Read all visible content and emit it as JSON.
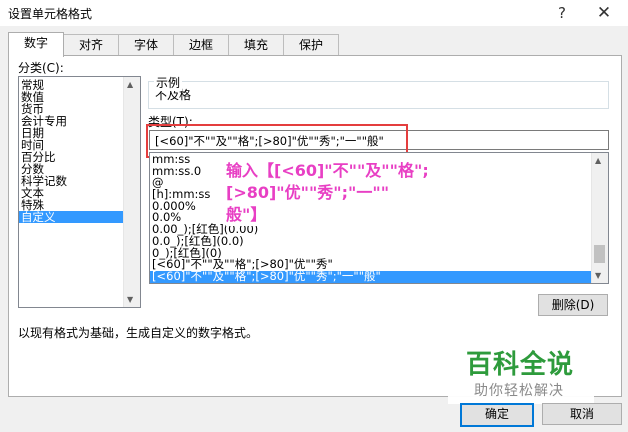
{
  "window": {
    "title": "设置单元格格式",
    "help_glyph": "?",
    "close_glyph": "✕"
  },
  "tabs": [
    "数字",
    "对齐",
    "字体",
    "边框",
    "填充",
    "保护"
  ],
  "category": {
    "label": "分类(C):",
    "items": [
      "常规",
      "数值",
      "货币",
      "会计专用",
      "日期",
      "时间",
      "百分比",
      "分数",
      "科学记数",
      "文本",
      "特殊",
      "自定义"
    ],
    "selected": "自定义"
  },
  "sample": {
    "label": "示例",
    "value": "不及格"
  },
  "type": {
    "label": "类型(T):",
    "value": "[<60]\"不\"\"及\"\"格\";[>80]\"优\"\"秀\";\"一\"\"般\"",
    "list": [
      "mm:ss",
      "mm:ss.0",
      "@",
      "[h]:mm:ss",
      "0.000%",
      "0.0%",
      "0.00_);[红色](0.00)",
      "0.0_);[红色](0.0)",
      "0_);[红色](0)",
      "[<60]\"不\"\"及\"\"格\";[>80]\"优\"\"秀\"",
      "[<60]\"不\"\"及\"\"格\";[>80]\"优\"\"秀\";\"一\"\"般\""
    ],
    "selected_index": 10
  },
  "annotation": {
    "line1": "输入【[<60]\"不\"\"及\"\"格\";[>80]\"优\"\"秀\";\"一\"\"",
    "line2": "般\"】"
  },
  "delete_button": "删除(D)",
  "description": "以现有格式为基础，生成自定义的数字格式。",
  "watermark": {
    "title": "百科全说",
    "subtitle": "助你轻松解决"
  },
  "buttons": {
    "ok": "确定",
    "cancel": "取消"
  },
  "colors": {
    "selection": "#3399ff",
    "annotation": "#e83fc4",
    "highlight_box": "#e43e3e",
    "watermark_green": "#2e9b3c"
  }
}
